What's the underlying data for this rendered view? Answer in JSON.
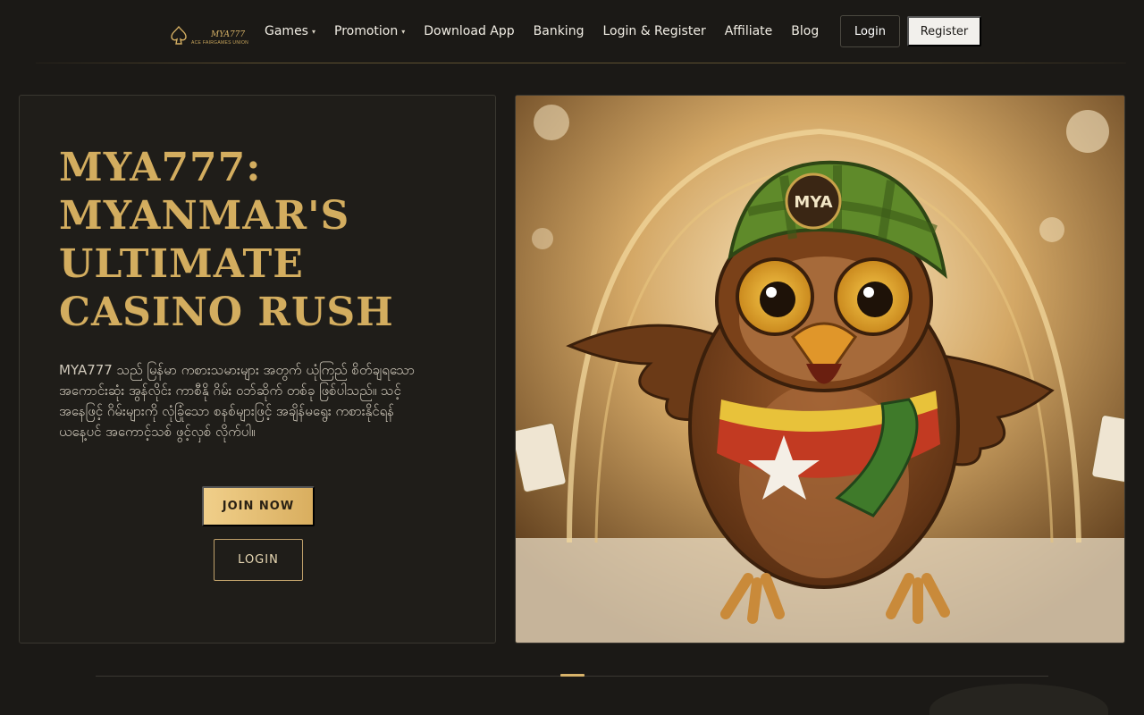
{
  "header": {
    "logo": {
      "brand": "MYA777",
      "tagline": "ACE FAIRGAMES UNION"
    },
    "nav": [
      {
        "label": "Games",
        "dropdown": true
      },
      {
        "label": "Promotion",
        "dropdown": true
      },
      {
        "label": "Download App",
        "dropdown": false
      },
      {
        "label": "Banking",
        "dropdown": false
      },
      {
        "label": "Login & Register",
        "dropdown": false
      },
      {
        "label": "Affiliate",
        "dropdown": false
      },
      {
        "label": "Blog",
        "dropdown": false
      }
    ],
    "caret": "⌄",
    "login_label": "Login",
    "register_label": "Register"
  },
  "hero": {
    "title": "MYA777: MYANMAR'S ULTIMATE CASINO RUSH",
    "description": "MYA777 သည် မြန်မာ ကစားသမားများ အတွက် ယုံကြည် စိတ်ချရသော အကောင်းဆုံး အွန်လိုင်း ကာစီနို ဂိမ်း ဝဘ်ဆိုက် တစ်ခု ဖြစ်ပါသည်။ သင့် အနေဖြင့် ဂိမ်းများကို လုံခြုံသော စနစ်များဖြင့် အချိန်မရွေး ကစားနိုင်ရန် ယနေ့ပင် အကောင့်သစ် ဖွင့်လှစ် လိုက်ပါ။",
    "join_label": "JOIN NOW",
    "login_label": "LOGIN",
    "image": {
      "cap_text": "MYA"
    }
  },
  "colors": {
    "gold": "#d3ad5f",
    "background": "#1b1916",
    "register_bg": "#f2f0ec"
  },
  "slider": {
    "active_index": 0,
    "count": 1
  }
}
